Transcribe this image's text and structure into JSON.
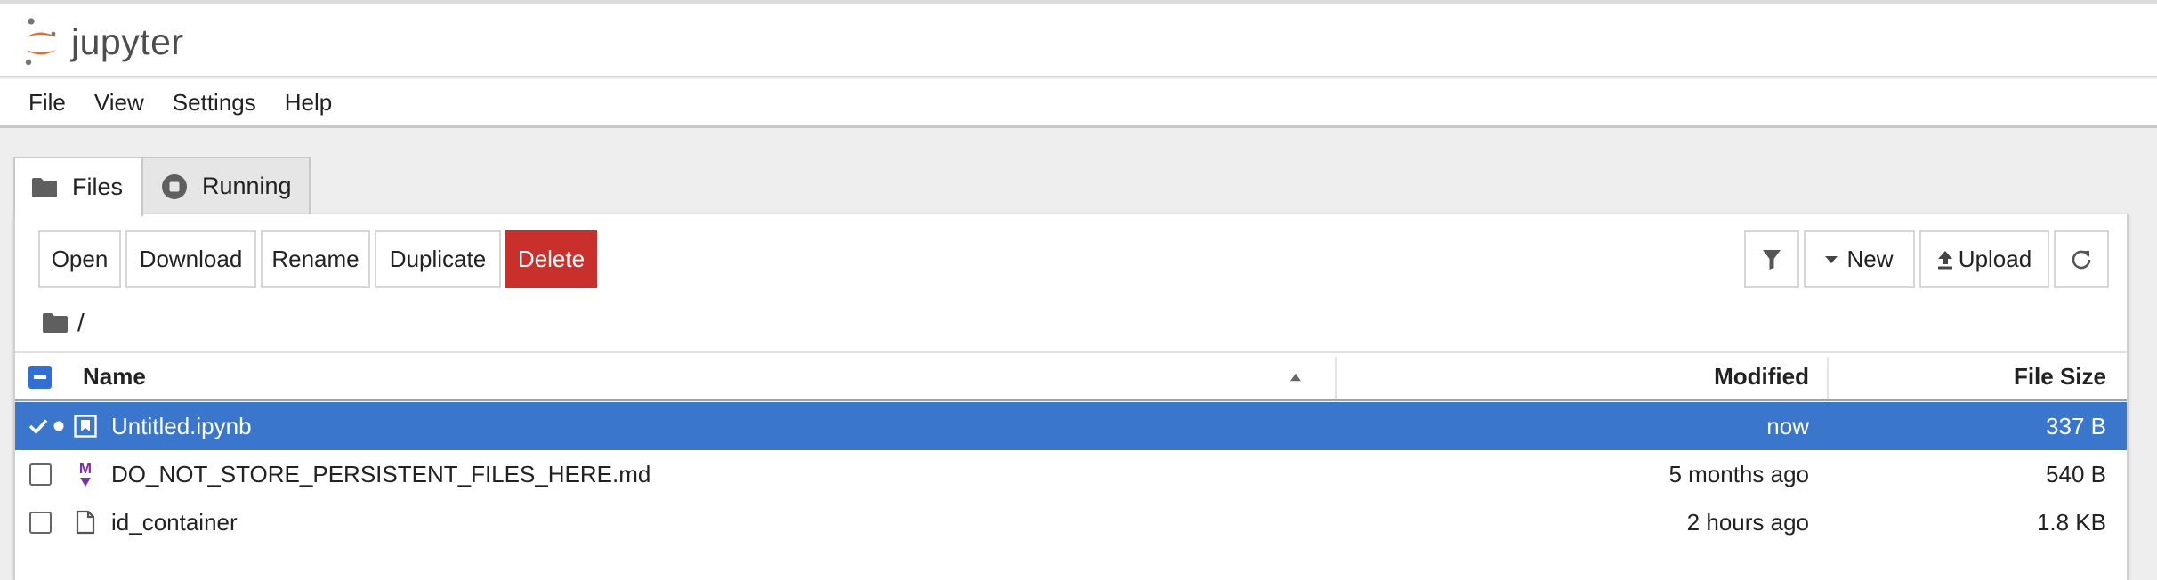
{
  "app": {
    "logo_text": "jupyter"
  },
  "menu": [
    "File",
    "View",
    "Settings",
    "Help"
  ],
  "tabs": {
    "files": "Files",
    "running": "Running"
  },
  "toolbar": {
    "open": "Open",
    "download": "Download",
    "rename": "Rename",
    "duplicate": "Duplicate",
    "delete": "Delete",
    "new": "New",
    "upload": "Upload"
  },
  "breadcrumb": {
    "path": "/"
  },
  "columns": {
    "name": "Name",
    "modified": "Modified",
    "size": "File Size"
  },
  "files": [
    {
      "name": "Untitled.ipynb",
      "modified": "now",
      "size": "337 B",
      "icon": "notebook-icon",
      "selected": true,
      "checked": true,
      "running": true
    },
    {
      "name": "DO_NOT_STORE_PERSISTENT_FILES_HERE.md",
      "modified": "5 months ago",
      "size": "540 B",
      "icon": "markdown-icon",
      "selected": false,
      "checked": false,
      "running": false
    },
    {
      "name": "id_container",
      "modified": "2 hours ago",
      "size": "1.8 KB",
      "icon": "file-icon",
      "selected": false,
      "checked": false,
      "running": false
    }
  ],
  "colors": {
    "selected_row": "#3a76cc",
    "delete_button": "#c9302c",
    "logo_orange": "#e46e2e",
    "markdown_purple": "#7b2fa8"
  }
}
